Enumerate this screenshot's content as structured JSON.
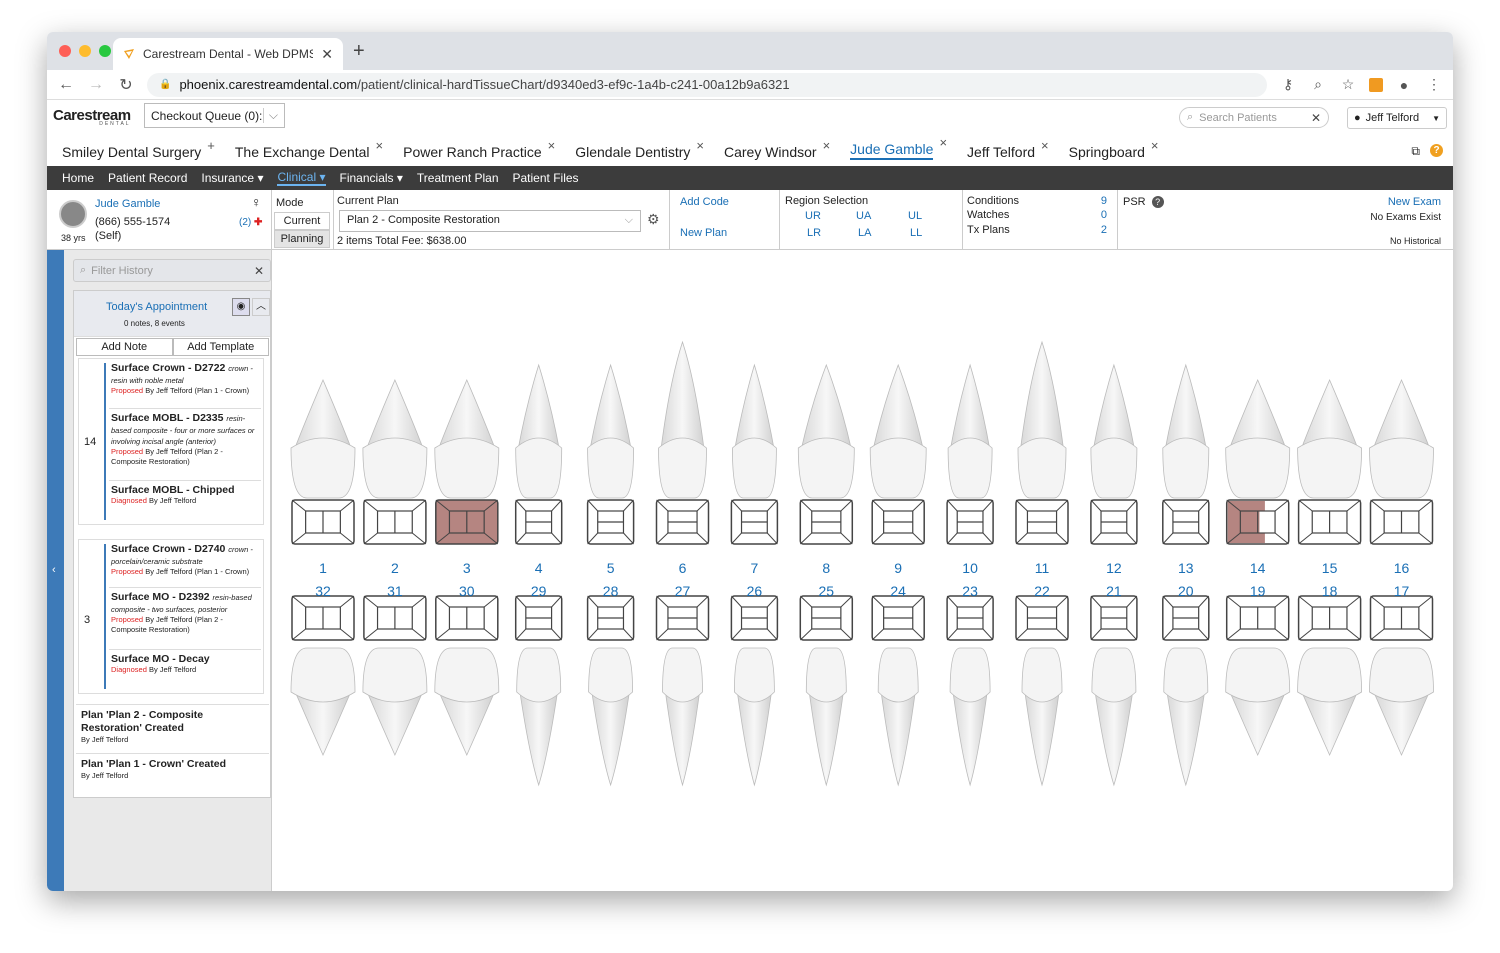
{
  "browser": {
    "tab_title": "Carestream Dental - Web DPMS",
    "url_domain": "phoenix.carestreamdental.com",
    "url_path": "/patient/clinical-hardTissueChart/d9340ed3-ef9c-1a4b-c241-00a12b9a6321"
  },
  "app": {
    "logo": "Carestream",
    "logo_sub": "DENTAL",
    "checkout_queue": "Checkout Queue (0):",
    "search_placeholder": "Search Patients",
    "user_name": "Jeff Telford"
  },
  "practice_tabs": [
    {
      "label": "Smiley Dental Surgery",
      "icon": "+"
    },
    {
      "label": "The Exchange Dental",
      "icon": "×"
    },
    {
      "label": "Power Ranch Practice",
      "icon": "×"
    },
    {
      "label": "Glendale Dentistry",
      "icon": "×"
    },
    {
      "label": "Carey Windsor",
      "icon": "×"
    },
    {
      "label": "Jude Gamble",
      "icon": "×"
    },
    {
      "label": "Jeff Telford",
      "icon": "×"
    },
    {
      "label": "Springboard",
      "icon": "×"
    }
  ],
  "menu": [
    "Home",
    "Patient Record",
    "Insurance ▾",
    "Clinical ▾",
    "Financials ▾",
    "Treatment Plan",
    "Patient Files"
  ],
  "patient": {
    "name": "Jude Gamble",
    "phone": "(866) 555-1574",
    "relation": "(Self)",
    "age": "38 yrs",
    "alerts": "(2)"
  },
  "mode": {
    "label": "Mode",
    "current": "Current",
    "planning": "Planning"
  },
  "plan": {
    "label": "Current Plan",
    "selected": "Plan 2 - Composite Restoration",
    "summary": "2 items Total Fee: $638.00"
  },
  "codes": {
    "add_code": "Add Code",
    "new_plan": "New Plan"
  },
  "region": {
    "label": "Region Selection",
    "items": [
      "UR",
      "UA",
      "UL",
      "LR",
      "LA",
      "LL"
    ]
  },
  "conditions": [
    {
      "label": "Conditions",
      "value": "9"
    },
    {
      "label": "Watches",
      "value": "0"
    },
    {
      "label": "Tx Plans",
      "value": "2"
    }
  ],
  "psr": {
    "label": "PSR",
    "new_exam": "New Exam",
    "no_exams": "No Exams Exist",
    "no_historical": "No Historical"
  },
  "sidebar": {
    "filter_placeholder": "Filter History",
    "appointment_title": "Today's Appointment",
    "appointment_sub": "0 notes,  8 events",
    "add_note": "Add Note",
    "add_template": "Add Template",
    "groups": [
      {
        "tooth": "14",
        "entries": [
          {
            "title": "Surface Crown - D2722",
            "desc_inline": "crown -",
            "desc": "resin with noble metal",
            "status": "Proposed",
            "by": "By Jeff Telford (Plan 1 - Crown)"
          },
          {
            "title": "Surface MOBL - D2335",
            "desc_inline": "resin-",
            "desc": "based composite - four or more surfaces or involving incisal angle (anterior)",
            "status": "Proposed",
            "by": "By Jeff Telford (Plan 2 - Composite Restoration)"
          },
          {
            "title": "Surface MOBL - Chipped",
            "desc_inline": "",
            "desc": "",
            "status": "Diagnosed",
            "by": "By Jeff Telford"
          }
        ]
      },
      {
        "tooth": "3",
        "entries": [
          {
            "title": "Surface Crown - D2740",
            "desc_inline": "crown -",
            "desc": "porcelain/ceramic substrate",
            "status": "Proposed",
            "by": "By Jeff Telford (Plan 1 - Crown)"
          },
          {
            "title": "Surface MO - D2392",
            "desc_inline": "resin-based",
            "desc": "composite - two surfaces, posterior",
            "status": "Proposed",
            "by": "By Jeff Telford (Plan 2 - Composite Restoration)"
          },
          {
            "title": "Surface MO - Decay",
            "desc_inline": "",
            "desc": "",
            "status": "Diagnosed",
            "by": "By Jeff Telford"
          }
        ]
      }
    ],
    "plans": [
      {
        "title": "Plan 'Plan 2 - Composite Restoration' Created",
        "by": "By Jeff Telford"
      },
      {
        "title": "Plan 'Plan 1 - Crown' Created",
        "by": "By Jeff Telford"
      }
    ]
  },
  "chart": {
    "upper_numbers": [
      "1",
      "2",
      "3",
      "4",
      "5",
      "6",
      "7",
      "8",
      "9",
      "10",
      "11",
      "12",
      "13",
      "14",
      "15",
      "16"
    ],
    "lower_numbers": [
      "32",
      "31",
      "30",
      "29",
      "28",
      "27",
      "26",
      "25",
      "24",
      "23",
      "22",
      "21",
      "20",
      "19",
      "18",
      "17"
    ],
    "highlight_color": "#b58581",
    "highlight_upper": [
      "3",
      "14"
    ],
    "number_color": "#1a6fb5"
  }
}
